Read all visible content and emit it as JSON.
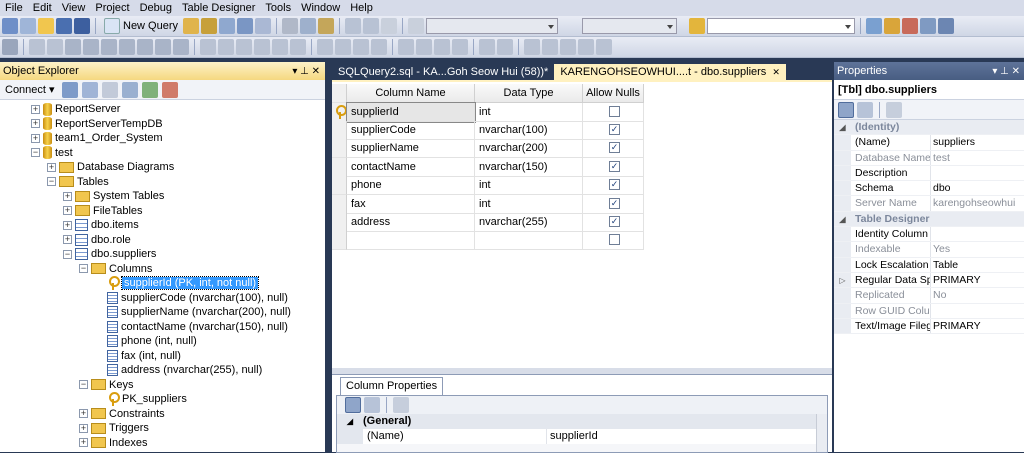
{
  "menu": [
    "File",
    "Edit",
    "View",
    "Project",
    "Debug",
    "Table Designer",
    "Tools",
    "Window",
    "Help"
  ],
  "toolbar": {
    "new_query_label": "New Query"
  },
  "object_explorer": {
    "title": "Object Explorer",
    "connect_label": "Connect ▾",
    "tree": [
      {
        "label": "ReportServer",
        "icon": "database-icon",
        "level": 2,
        "toggle": "+"
      },
      {
        "label": "ReportServerTempDB",
        "icon": "database-icon",
        "level": 2,
        "toggle": "+"
      },
      {
        "label": "team1_Order_System",
        "icon": "database-icon",
        "level": 2,
        "toggle": "+"
      },
      {
        "label": "test",
        "icon": "database-icon",
        "level": 2,
        "toggle": "−"
      },
      {
        "label": "Database Diagrams",
        "icon": "folder-icon",
        "level": 3,
        "toggle": "+"
      },
      {
        "label": "Tables",
        "icon": "folder-icon",
        "level": 3,
        "toggle": "−"
      },
      {
        "label": "System Tables",
        "icon": "folder-icon",
        "level": 4,
        "toggle": "+"
      },
      {
        "label": "FileTables",
        "icon": "folder-icon",
        "level": 4,
        "toggle": "+"
      },
      {
        "label": "dbo.items",
        "icon": "table-icon",
        "level": 4,
        "toggle": "+"
      },
      {
        "label": "dbo.role",
        "icon": "table-icon",
        "level": 4,
        "toggle": "+"
      },
      {
        "label": "dbo.suppliers",
        "icon": "table-icon",
        "level": 4,
        "toggle": "−"
      },
      {
        "label": "Columns",
        "icon": "folder-icon",
        "level": 5,
        "toggle": "−"
      },
      {
        "label": "supplierId (PK, int, not null)",
        "icon": "key-icon",
        "level": 6,
        "toggle": "",
        "selected": true
      },
      {
        "label": "supplierCode (nvarchar(100), null)",
        "icon": "column-icon",
        "level": 6,
        "toggle": ""
      },
      {
        "label": "supplierName (nvarchar(200), null)",
        "icon": "column-icon",
        "level": 6,
        "toggle": ""
      },
      {
        "label": "contactName (nvarchar(150), null)",
        "icon": "column-icon",
        "level": 6,
        "toggle": ""
      },
      {
        "label": "phone (int, null)",
        "icon": "column-icon",
        "level": 6,
        "toggle": ""
      },
      {
        "label": "fax (int, null)",
        "icon": "column-icon",
        "level": 6,
        "toggle": ""
      },
      {
        "label": "address (nvarchar(255), null)",
        "icon": "column-icon",
        "level": 6,
        "toggle": ""
      },
      {
        "label": "Keys",
        "icon": "folder-icon",
        "level": 5,
        "toggle": "−"
      },
      {
        "label": "PK_suppliers",
        "icon": "key-icon",
        "level": 6,
        "toggle": ""
      },
      {
        "label": "Constraints",
        "icon": "folder-icon",
        "level": 5,
        "toggle": "+"
      },
      {
        "label": "Triggers",
        "icon": "folder-icon",
        "level": 5,
        "toggle": "+"
      },
      {
        "label": "Indexes",
        "icon": "folder-icon",
        "level": 5,
        "toggle": "+"
      }
    ]
  },
  "tabs": [
    {
      "label": "SQLQuery2.sql - KA...Goh Seow Hui (58))*",
      "active": false
    },
    {
      "label": "KARENGOHSEOWHUI....t - dbo.suppliers",
      "active": true,
      "close": "✕"
    }
  ],
  "designer": {
    "headers": [
      "Column Name",
      "Data Type",
      "Allow Nulls"
    ],
    "rows": [
      {
        "name": "supplierId",
        "type": "int",
        "nulls": false,
        "pk": true
      },
      {
        "name": "supplierCode",
        "type": "nvarchar(100)",
        "nulls": true
      },
      {
        "name": "supplierName",
        "type": "nvarchar(200)",
        "nulls": true
      },
      {
        "name": "contactName",
        "type": "nvarchar(150)",
        "nulls": true
      },
      {
        "name": "phone",
        "type": "int",
        "nulls": true
      },
      {
        "name": "fax",
        "type": "int",
        "nulls": true
      },
      {
        "name": "address",
        "type": "nvarchar(255)",
        "nulls": true
      },
      {
        "name": "",
        "type": "",
        "nulls": false
      }
    ]
  },
  "column_properties": {
    "tab_label": "Column Properties",
    "section": "(General)",
    "rows": [
      {
        "name": "(Name)",
        "value": "supplierId"
      }
    ]
  },
  "properties": {
    "title": "Properties",
    "object": "[Tbl] dbo.suppliers",
    "rows": [
      {
        "cat": true,
        "name": "(Identity)",
        "exp": "◢"
      },
      {
        "name": "(Name)",
        "value": "suppliers"
      },
      {
        "name": "Database Name",
        "value": "test",
        "ro": true
      },
      {
        "name": "Description",
        "value": ""
      },
      {
        "name": "Schema",
        "value": "dbo"
      },
      {
        "name": "Server Name",
        "value": "karengohseowhui",
        "ro": true
      },
      {
        "cat": true,
        "name": "Table Designer",
        "exp": "◢"
      },
      {
        "name": "Identity Column",
        "value": ""
      },
      {
        "name": "Indexable",
        "value": "Yes",
        "ro": true
      },
      {
        "name": "Lock Escalation",
        "value": "Table"
      },
      {
        "name": "Regular Data Space",
        "value": "PRIMARY",
        "exp": "▷"
      },
      {
        "name": "Replicated",
        "value": "No",
        "ro": true
      },
      {
        "name": "Row GUID Column",
        "value": "",
        "ro": true
      },
      {
        "name": "Text/Image Filegroup",
        "value": "PRIMARY"
      }
    ]
  },
  "colors": {
    "accent": "#3399ff",
    "chrome": "#293955",
    "tab_active": "#fff1c0"
  }
}
